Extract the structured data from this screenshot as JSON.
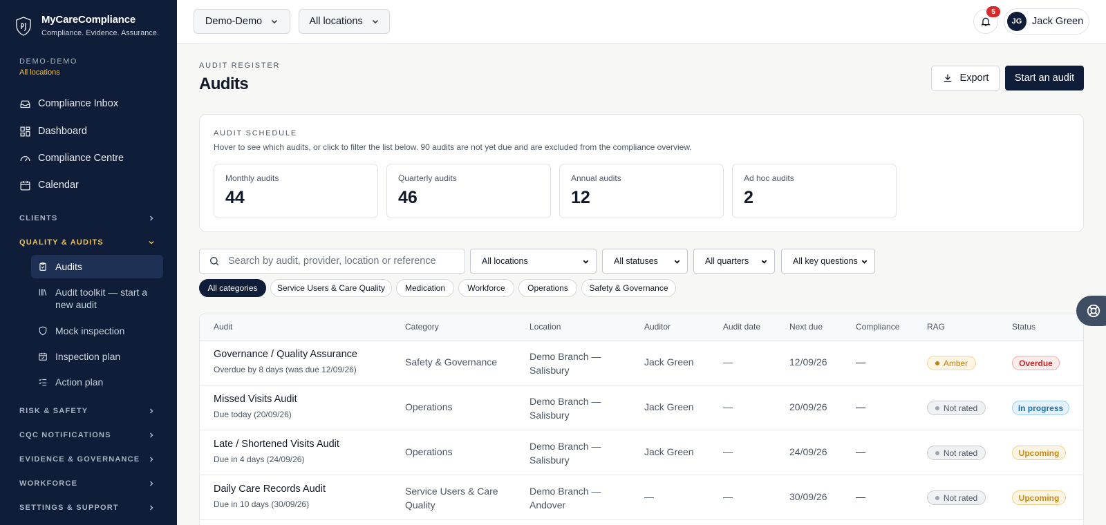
{
  "brand": {
    "name": "MyCareCompliance",
    "tagline": "Compliance. Evidence. Assurance."
  },
  "org": {
    "name": "DEMO-DEMO",
    "location": "All locations"
  },
  "nav": {
    "main": [
      {
        "label": "Compliance Inbox",
        "icon": "inbox-icon"
      },
      {
        "label": "Dashboard",
        "icon": "dashboard-grid-icon"
      },
      {
        "label": "Compliance Centre",
        "icon": "gauge-icon"
      },
      {
        "label": "Calendar",
        "icon": "calendar-icon"
      }
    ],
    "sections": {
      "clients": "CLIENTS",
      "quality": "QUALITY & AUDITS",
      "risk": "RISK & SAFETY",
      "cqc": "CQC NOTIFICATIONS",
      "evidence": "EVIDENCE & GOVERNANCE",
      "workforce": "WORKFORCE",
      "settings": "SETTINGS & SUPPORT"
    },
    "quality_items": [
      {
        "label": "Audits",
        "icon": "clipboard-check-icon",
        "active": true
      },
      {
        "label": "Audit toolkit — start a new audit",
        "icon": "library-icon"
      },
      {
        "label": "Mock inspection",
        "icon": "shield-icon"
      },
      {
        "label": "Inspection plan",
        "icon": "calendar-check-icon"
      },
      {
        "label": "Action plan",
        "icon": "checklist-icon"
      }
    ]
  },
  "topbar": {
    "org_select": "Demo-Demo",
    "location_select": "All locations",
    "notification_count": "5",
    "user": {
      "initials": "JG",
      "name": "Jack Green"
    }
  },
  "header": {
    "eyebrow": "AUDIT REGISTER",
    "title": "Audits",
    "export_label": "Export",
    "start_label": "Start an audit"
  },
  "schedule": {
    "eyebrow": "AUDIT SCHEDULE",
    "description": "Hover to see which audits, or click to filter the list below. 90 audits are not yet due and are excluded from the compliance overview.",
    "stats": [
      {
        "label": "Monthly audits",
        "value": "44"
      },
      {
        "label": "Quarterly audits",
        "value": "46"
      },
      {
        "label": "Annual audits",
        "value": "12"
      },
      {
        "label": "Ad hoc audits",
        "value": "2"
      }
    ]
  },
  "filters": {
    "search_placeholder": "Search by audit, provider, location or reference",
    "locations": "All locations",
    "statuses": "All statuses",
    "quarters": "All quarters",
    "key_questions": "All key questions",
    "categories": [
      "All categories",
      "Service Users & Care Quality",
      "Medication",
      "Workforce",
      "Operations",
      "Safety & Governance"
    ]
  },
  "table": {
    "columns": [
      "Audit",
      "Category",
      "Location",
      "Auditor",
      "Audit date",
      "Next due",
      "Compliance",
      "RAG",
      "Status"
    ],
    "rows": [
      {
        "name": "Governance / Quality Assurance",
        "sub": "Overdue by 8 days (was due 12/09/26)",
        "category": "Safety & Governance",
        "location": "Demo Branch — Salisbury",
        "auditor": "Jack Green",
        "audit_date": "—",
        "next_due": "12/09/26",
        "compliance": "—",
        "rag": "Amber",
        "status": "Overdue"
      },
      {
        "name": "Missed Visits Audit",
        "sub": "Due today (20/09/26)",
        "category": "Operations",
        "location": "Demo Branch — Salisbury",
        "auditor": "Jack Green",
        "audit_date": "—",
        "next_due": "20/09/26",
        "compliance": "—",
        "rag": "Not rated",
        "status": "In progress"
      },
      {
        "name": "Late / Shortened Visits Audit",
        "sub": "Due in 4 days (24/09/26)",
        "category": "Operations",
        "location": "Demo Branch — Salisbury",
        "auditor": "Jack Green",
        "audit_date": "—",
        "next_due": "24/09/26",
        "compliance": "—",
        "rag": "Not rated",
        "status": "Upcoming"
      },
      {
        "name": "Daily Care Records Audit",
        "sub": "Due in 10 days (30/09/26)",
        "category": "Service Users & Care Quality",
        "location": "Demo Branch — Andover",
        "auditor": "—",
        "audit_date": "—",
        "next_due": "30/09/26",
        "compliance": "—",
        "rag": "Not rated",
        "status": "Upcoming"
      }
    ]
  },
  "colors": {
    "sidebar": "#0f1d38",
    "accent_gold": "#f1c14e",
    "overdue": "#c02626",
    "in_progress": "#1c6fb0",
    "upcoming": "#c88a10"
  }
}
